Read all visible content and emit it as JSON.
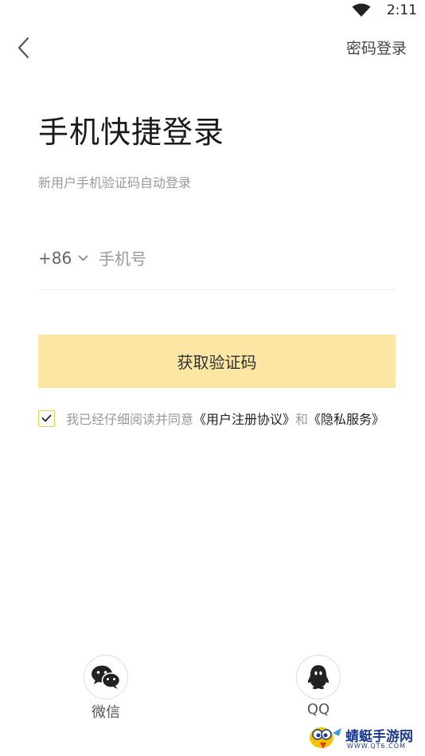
{
  "status_bar": {
    "time": "2:11"
  },
  "header": {
    "password_login": "密码登录"
  },
  "main": {
    "title": "手机快捷登录",
    "subtitle": "新用户手机验证码自动登录",
    "country_code": "+86",
    "phone_placeholder": "手机号",
    "phone_value": "",
    "get_code_label": "获取验证码",
    "agreement": {
      "checked": true,
      "prefix": "我已经仔细阅读并同意",
      "user_agreement": "《用户注册协议》",
      "and": "和",
      "privacy": "《隐私服务》"
    }
  },
  "social": [
    {
      "label": "微信",
      "icon": "wechat-icon"
    },
    {
      "label": "QQ",
      "icon": "qq-icon"
    }
  ],
  "watermark": {
    "title": "蜻蜓手游网",
    "url": "WWW.QT6.COM"
  },
  "colors": {
    "accent": "#f2c94c",
    "button_bg": "#fbe7a3",
    "text_primary": "#1a1a1a",
    "text_secondary": "#999999"
  }
}
